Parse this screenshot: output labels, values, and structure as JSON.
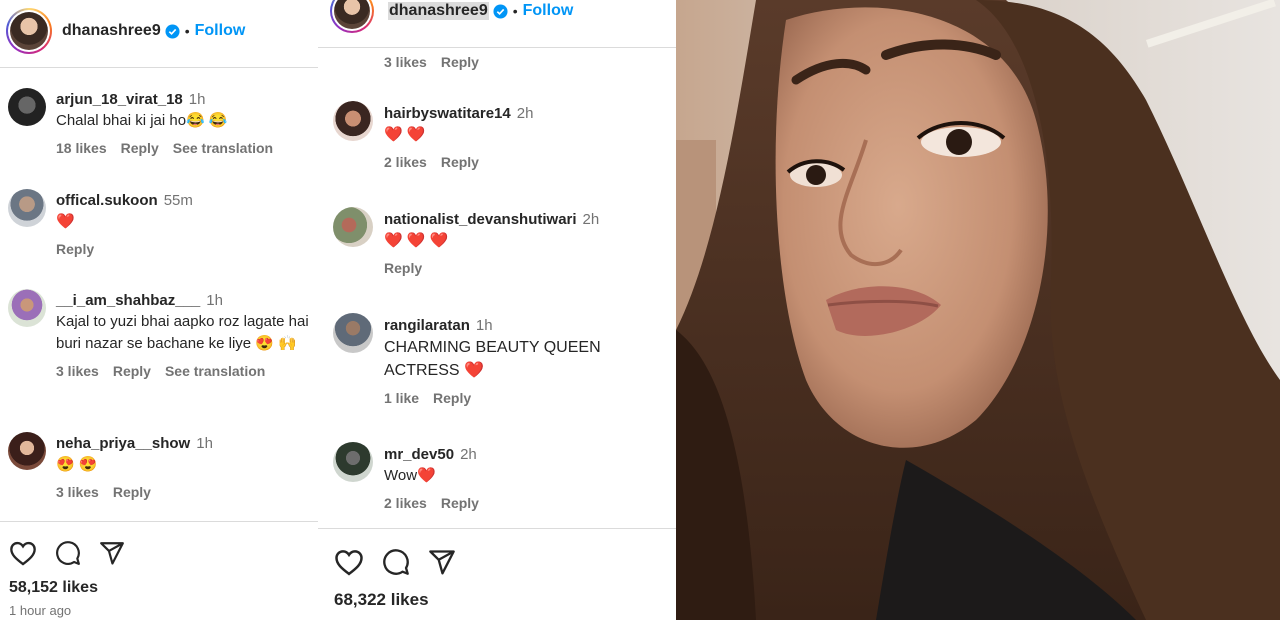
{
  "left": {
    "header": {
      "username": "dhanashree9",
      "separator": "•",
      "follow": "Follow"
    },
    "comments": [
      {
        "user": "arjun_18_virat_18",
        "time": "1h",
        "text": "Chalal bhai ki jai ho😂 😂",
        "likes": "18 likes",
        "reply": "Reply",
        "translate": "See translation"
      },
      {
        "user": "offical.sukoon",
        "time": "55m",
        "text": "❤️",
        "reply": "Reply"
      },
      {
        "user": "__i_am_shahbaz___",
        "time": "1h",
        "text": "Kajal to yuzi bhai aapko roz lagate hai buri nazar se bachane ke liye 😍 🙌",
        "likes": "3 likes",
        "reply": "Reply",
        "translate": "See translation"
      },
      {
        "user": "neha_priya__show",
        "time": "1h",
        "text": "😍 😍",
        "likes": "3 likes",
        "reply": "Reply"
      }
    ],
    "likes": "58,152 likes",
    "posted": "1 hour ago"
  },
  "mid": {
    "header": {
      "username": "dhanashree9",
      "separator": "•",
      "follow": "Follow"
    },
    "top_meta": {
      "likes": "3 likes",
      "reply": "Reply"
    },
    "comments": [
      {
        "user": "hairbyswatitare14",
        "time": "2h",
        "text": "❤️ ❤️",
        "likes": "2 likes",
        "reply": "Reply"
      },
      {
        "user": "nationalist_devanshutiwari",
        "time": "2h",
        "text": "❤️ ❤️ ❤️",
        "reply": "Reply"
      },
      {
        "user": "rangilaratan",
        "time": "1h",
        "text": "CHARMING BEAUTY QUEEN ACTRESS ❤️",
        "likes": "1 like",
        "reply": "Reply"
      },
      {
        "user": "mr_dev50",
        "time": "2h",
        "text": "Wow❤️",
        "likes": "2 likes",
        "reply": "Reply"
      }
    ],
    "likes": "68,322 likes"
  },
  "colors": {
    "link": "#0095f6",
    "text": "#262626",
    "muted": "#737373",
    "heart": "#e0245e",
    "divider": "#dbdbdb"
  },
  "icons": [
    "heart-icon",
    "comment-icon",
    "share-icon",
    "verified-icon"
  ]
}
